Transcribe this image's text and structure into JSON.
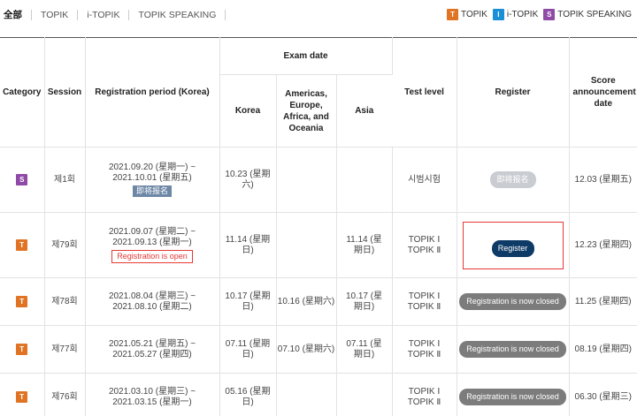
{
  "tabs": [
    "全部",
    "TOPIK",
    "i-TOPIK",
    "TOPIK SPEAKING"
  ],
  "legend": [
    {
      "badge": "T",
      "label": "TOPIK",
      "color": "#e07424"
    },
    {
      "badge": "I",
      "label": "i-TOPIK",
      "color": "#1a8fd6"
    },
    {
      "badge": "S",
      "label": "TOPIK SPEAKING",
      "color": "#8e4aa6"
    }
  ],
  "table": {
    "headers": {
      "category": "Category",
      "session": "Session",
      "registration": "Registration period (Korea)",
      "exam_date": "Exam date",
      "korea": "Korea",
      "americas": "Americas, Europe, Africa, and Oceania",
      "asia": "Asia",
      "level": "Test level",
      "register": "Register",
      "score": "Score announcement date"
    },
    "rows": [
      {
        "badge": "S",
        "session": "제1회",
        "period": "2021.09.20 (星期一) ~ 2021.10.01 (星期五)",
        "status": "即将报名",
        "korea": "10.23 (星期六)",
        "americas": "",
        "asia": "",
        "level1": "시범시험",
        "level2": "",
        "action": "即将报名",
        "score": "12.03 (星期五)"
      },
      {
        "badge": "T",
        "session": "제79회",
        "period": "2021.09.07 (星期二) ~ 2021.09.13 (星期一)",
        "status": "Registration is open",
        "korea": "11.14 (星期日)",
        "americas": "",
        "asia": "11.14 (星期日)",
        "level1": "TOPIK Ⅰ",
        "level2": "TOPIK Ⅱ",
        "action": "Register",
        "score": "12.23 (星期四)"
      },
      {
        "badge": "T",
        "session": "제78회",
        "period": "2021.08.04 (星期三) ~ 2021.08.10 (星期二)",
        "status": "",
        "korea": "10.17 (星期日)",
        "americas": "10.16 (星期六)",
        "asia": "10.17 (星期日)",
        "level1": "TOPIK Ⅰ",
        "level2": "TOPIK Ⅱ",
        "action": "Registration is now closed",
        "score": "11.25 (星期四)"
      },
      {
        "badge": "T",
        "session": "제77회",
        "period": "2021.05.21 (星期五) ~ 2021.05.27 (星期四)",
        "status": "",
        "korea": "07.11 (星期日)",
        "americas": "07.10 (星期六)",
        "asia": "07.11 (星期日)",
        "level1": "TOPIK Ⅰ",
        "level2": "TOPIK Ⅱ",
        "action": "Registration is now closed",
        "score": "08.19 (星期四)"
      },
      {
        "badge": "T",
        "session": "제76회",
        "period": "2021.03.10 (星期三) ~ 2021.03.15 (星期一)",
        "status": "",
        "korea": "05.16 (星期日)",
        "americas": "",
        "asia": "",
        "level1": "TOPIK Ⅰ",
        "level2": "TOPIK Ⅱ",
        "action": "Registration is now closed",
        "score": "06.30 (星期三)"
      }
    ]
  }
}
